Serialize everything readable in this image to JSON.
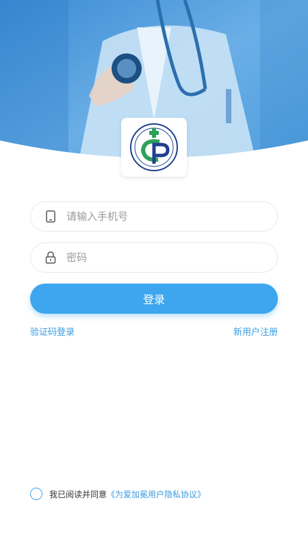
{
  "header": {
    "image_icon": "doctor-stethoscope-photo",
    "logo_icon": "organization-logo"
  },
  "login_form": {
    "phone_placeholder": "请输入手机号",
    "phone_icon": "phone-icon",
    "password_placeholder": "密码",
    "password_icon": "lock-icon",
    "login_label": "登录"
  },
  "links": {
    "sms_login": "验证码登录",
    "register": "新用户注册"
  },
  "agreement": {
    "prefix": "我已阅读并同意",
    "link": "《为爱加冕用户隐私协议》"
  },
  "colors": {
    "accent": "#3ea6ee",
    "link": "#3a9be0",
    "header_blue": "#3d8fd6"
  }
}
